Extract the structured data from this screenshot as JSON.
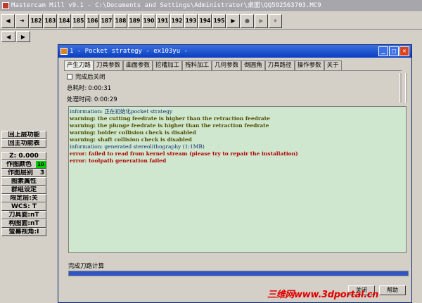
{
  "app": {
    "title": "Mastercam Mill v9.1 - C:\\Documents and Settings\\Administrator\\桌面\\QQ592563703.MC9"
  },
  "toolbar": {
    "nav_buttons": [
      "◀",
      "➜"
    ],
    "numbers": [
      "182",
      "183",
      "184",
      "185",
      "186",
      "187",
      "188",
      "189",
      "190",
      "191",
      "192",
      "193",
      "194",
      "195"
    ],
    "controls": [
      "▶",
      "●",
      "▶",
      "⏸"
    ]
  },
  "left_panel": {
    "back_function": "回上层功能",
    "main_function": "回主功能表",
    "z": "Z:  0.000",
    "color_label": "作图颜色",
    "color_value": "10",
    "layer_label": "作图层别",
    "layer_value": "3",
    "attributes": "图素属性",
    "group": "群组设定",
    "limit_layer": "限定层:关",
    "wcs": "WCS:  T",
    "tool_plane": "刀具面:nT",
    "construction_plane": "构图面:nT",
    "screen_view": "萤幕视角:I"
  },
  "dialog": {
    "title": "1 - Pocket strategy - ex103yu -",
    "buttons": {
      "minimize": "_",
      "maximize": "□",
      "close": "✕"
    },
    "tabs": [
      "产生刀路",
      "刀具参数",
      "曲面参数",
      "挖槽加工",
      "残料加工",
      "几何参数",
      "倒圆角",
      "刀具路径",
      "操作参数",
      "关于"
    ],
    "close_after": "完成后关闭",
    "total_time_label": "总耗时:",
    "total_time": "0:00:31",
    "process_time_label": "处理时间:",
    "process_time": "0:00:29",
    "log": [
      {
        "type": "info",
        "text": "information: 正在初始化pocket strategy"
      },
      {
        "type": "warn",
        "text": "warning: the cutting feedrate is higher than the retraction feedrate"
      },
      {
        "type": "warn",
        "text": "warning: the plunge feedrate is higher than the retraction feedrate"
      },
      {
        "type": "warn",
        "text": "warning: holder collision check is disabled"
      },
      {
        "type": "warn",
        "text": "warning: shaft collision check is disabled"
      },
      {
        "type": "info",
        "text": "information: generated stereolithography (1:1MB)"
      },
      {
        "type": "err",
        "text": "error: failed to read from kernel stream (please try to repair the installation)"
      },
      {
        "type": "err",
        "text": "error: toolpath generation failed"
      }
    ],
    "status": "完成刀路计算",
    "progress": 1.0,
    "footer_close": "关闭",
    "footer_help": "帮助"
  },
  "watermark": "三维网www.3dportal.cn",
  "colors": {
    "log_bg": "#cfe6cf",
    "progress": "#2f55c8",
    "title_bar": "#0a3fc0"
  }
}
